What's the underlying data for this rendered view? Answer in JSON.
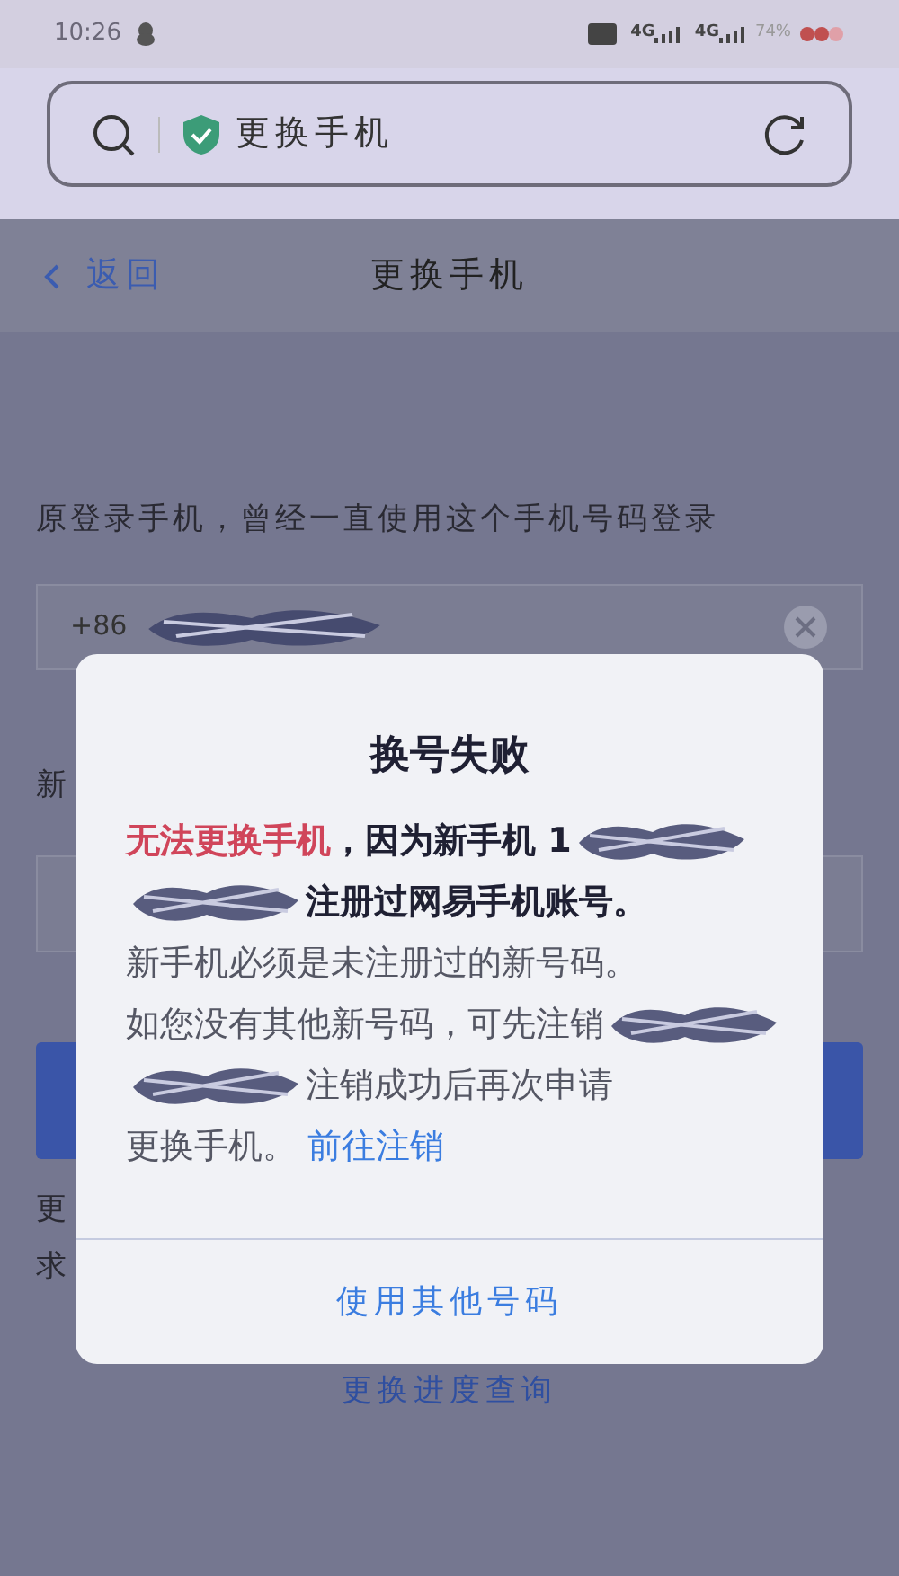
{
  "status_bar": {
    "time": "10:26",
    "network_1": "4G",
    "network_2": "4G",
    "battery": "74%"
  },
  "address_bar": {
    "title": "更换手机"
  },
  "nav": {
    "back": "返回",
    "title": "更换手机"
  },
  "form": {
    "intro": "原登录手机，曾经一直使用这个手机号码登录",
    "old_phone": {
      "prefix": "+86",
      "redacted": true
    },
    "new_label": "新",
    "note_lines": [
      "更",
      "求"
    ],
    "progress_link": "更换进度查询"
  },
  "dialog": {
    "title": "换号失败",
    "lines": [
      [
        {
          "kind": "warning",
          "text": "无法更换手机"
        },
        {
          "kind": "emphasis",
          "text": "，因为新手机 1"
        },
        {
          "kind": "redacted"
        }
      ],
      [
        {
          "kind": "redacted"
        },
        {
          "kind": "emphasis",
          "text": "注册过网易手机账号。"
        }
      ],
      [
        {
          "kind": "normal",
          "text": "新手机必须是未注册过的新号码。"
        }
      ],
      [
        {
          "kind": "normal",
          "text": "如您没有其他新号码，可先注销"
        },
        {
          "kind": "redacted"
        }
      ],
      [
        {
          "kind": "redacted"
        },
        {
          "kind": "normal",
          "text": "注销成功后再次申请"
        }
      ],
      [
        {
          "kind": "normal",
          "text": "更换手机。"
        },
        {
          "kind": "link",
          "text": "前往注销"
        }
      ]
    ],
    "button": "使用其他号码"
  }
}
